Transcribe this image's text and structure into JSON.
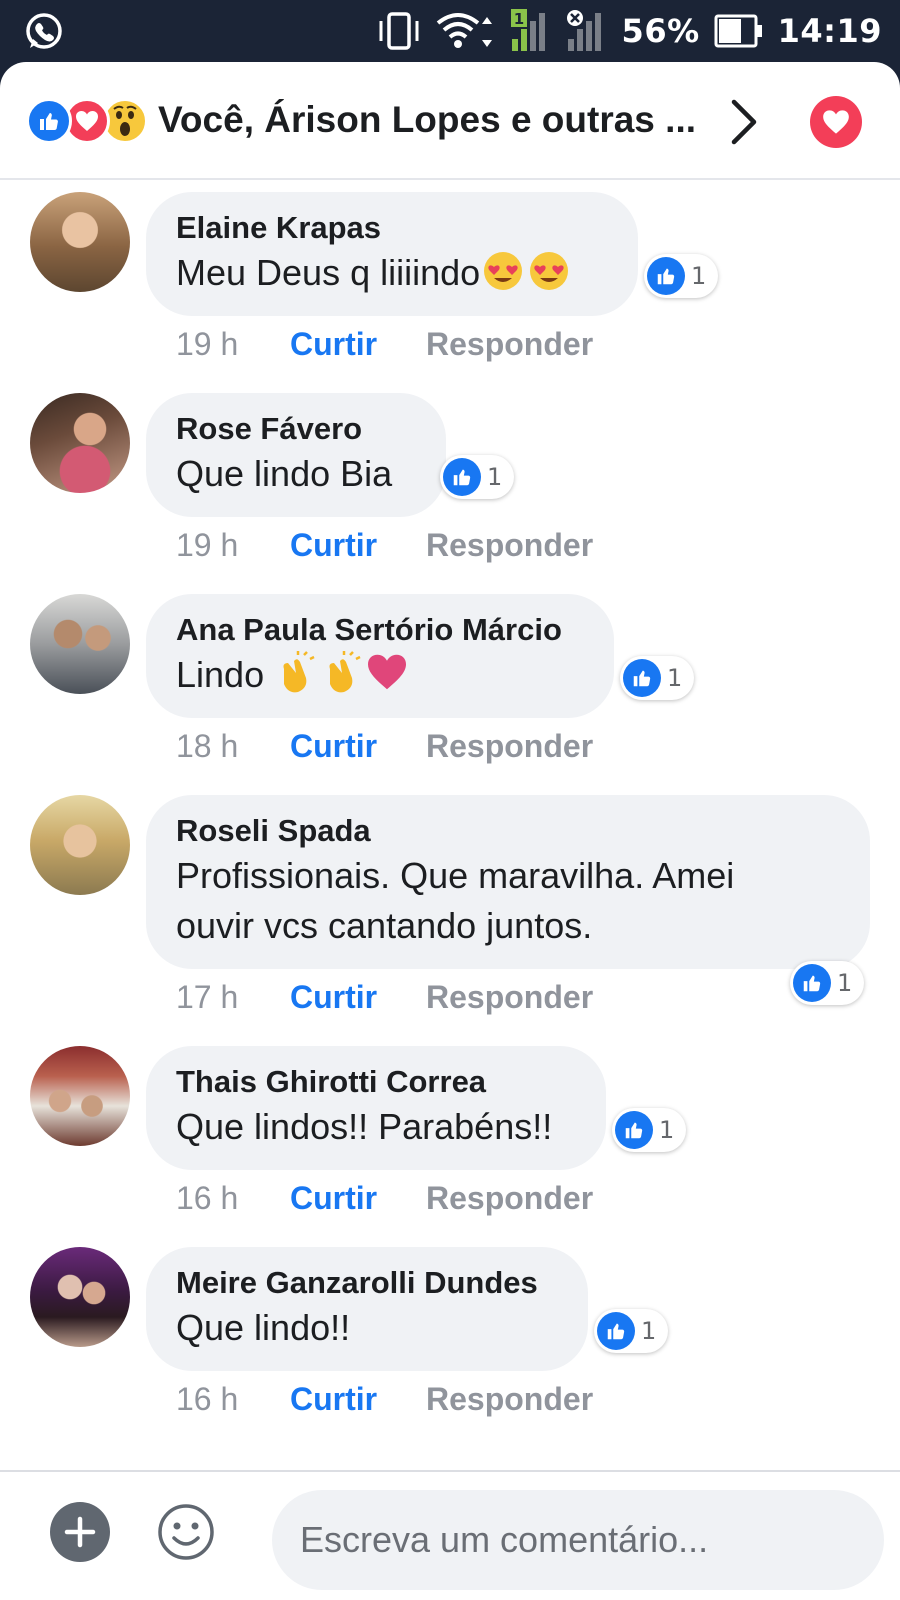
{
  "status_bar": {
    "battery": "56%",
    "time": "14:19",
    "sim_badge": "1",
    "icons": [
      "whatsapp-icon",
      "vibrate-icon",
      "wifi-icon",
      "signal-icon",
      "no-signal-icon",
      "battery-icon"
    ]
  },
  "header": {
    "title": "Você, Árison Lopes e outras ...",
    "reaction_icons": [
      "like-reaction-icon",
      "love-reaction-icon",
      "wow-reaction-icon"
    ],
    "chevron_icon": "chevron-right-icon",
    "love_icon": "love-icon"
  },
  "comments": [
    {
      "name": "Elaine Krapas",
      "text": "Meu Deus q liiiindo",
      "emoji": [
        "heart-eyes",
        "heart-eyes"
      ],
      "likes": "1",
      "time": "19 h",
      "like_label": "Curtir",
      "reply_label": "Responder"
    },
    {
      "name": "Rose Fávero",
      "text": "Que lindo Bia",
      "emoji": [],
      "likes": "1",
      "time": "19 h",
      "like_label": "Curtir",
      "reply_label": "Responder"
    },
    {
      "name": "Ana Paula Sertório Márcio",
      "text": "Lindo ",
      "emoji": [
        "clapping-hands",
        "clapping-hands",
        "heart"
      ],
      "likes": "1",
      "time": "18 h",
      "like_label": "Curtir",
      "reply_label": "Responder"
    },
    {
      "name": "Roseli Spada",
      "text_lines": [
        "Profissionais. Que maravilha.  Amei",
        "ouvir vcs cantando juntos."
      ],
      "likes": "1",
      "time": "17 h",
      "like_label": "Curtir",
      "reply_label": "Responder"
    },
    {
      "name": "Thais Ghirotti Correa",
      "text": "Que lindos!! Parabéns!!",
      "emoji": [],
      "likes": "1",
      "time": "16 h",
      "like_label": "Curtir",
      "reply_label": "Responder"
    },
    {
      "name": "Meire Ganzarolli Dundes",
      "text": "Que lindo!!",
      "emoji": [],
      "likes": "1",
      "time": "16 h",
      "like_label": "Curtir",
      "reply_label": "Responder"
    }
  ],
  "composer": {
    "placeholder": "Escreva um comentário...",
    "add_icon": "plus-icon",
    "emoji_icon": "smiley-icon"
  },
  "colors": {
    "status_bar_bg": "#1b2436",
    "accent_blue": "#1877f2",
    "love_red": "#f33e58",
    "bubble_gray": "#f0f2f5",
    "meta_gray": "#90949c"
  }
}
